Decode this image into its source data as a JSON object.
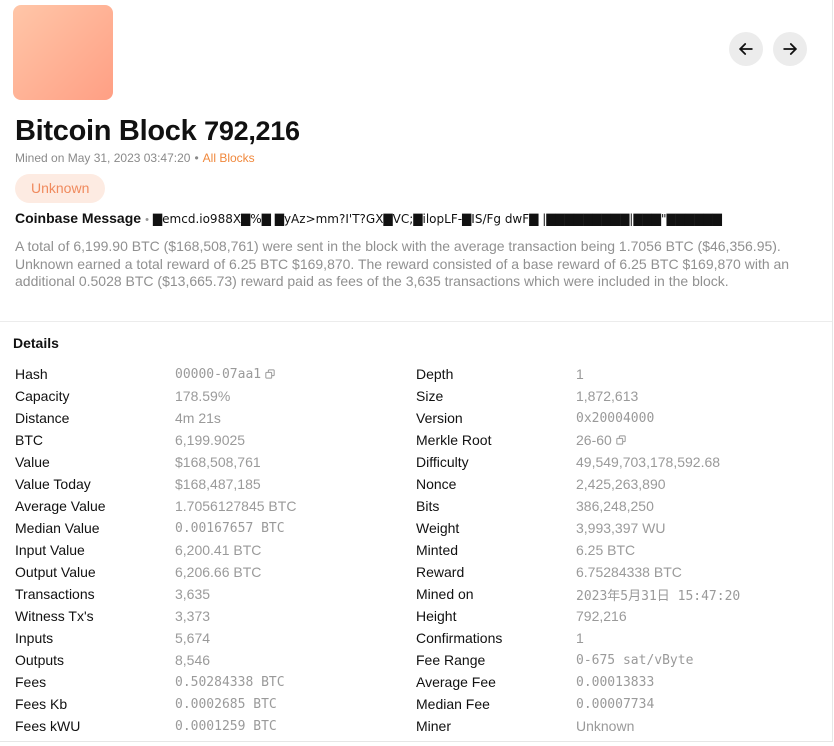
{
  "header": {
    "title_word": "Bitcoin Block",
    "block_number": "792,216",
    "mined_text": "Mined on May 31, 2023 03:47:20",
    "dot": "•",
    "all_blocks_link": "All Blocks",
    "miner_badge": "Unknown"
  },
  "coinbase": {
    "label": "Coinbase Message",
    "separator": "•",
    "message": "▇emcd.io988X▇%▇ ▇yAz>mm?I'T?GX▇VC;▇ilopLF-▇IS/Fg dwF▇ |▇▇▇▇▇▇▇▇▇|▇▇▇\"▇▇▇▇▇▇"
  },
  "summary": "A total of 6,199.90 BTC ($168,508,761) were sent in the block with the average transaction being 1.7056 BTC ($46,356.95). Unknown earned a total reward of 6.25 BTC $169,870. The reward consisted of a base reward of 6.25 BTC $169,870 with an additional 0.5028 BTC ($13,665.73) reward paid as fees of the 3,635 transactions which were included in the block.",
  "details": {
    "heading": "Details",
    "left": [
      {
        "label": "Hash",
        "value": "00000-07aa1",
        "copy": true
      },
      {
        "label": "Capacity",
        "value": "178.59%"
      },
      {
        "label": "Distance",
        "value": "4m 21s"
      },
      {
        "label": "BTC",
        "value": "6,199.9025"
      },
      {
        "label": "Value",
        "value": "$168,508,761"
      },
      {
        "label": "Value Today",
        "value": "$168,487,185"
      },
      {
        "label": "Average Value",
        "value": "1.7056127845 BTC"
      },
      {
        "label": "Median Value",
        "value": "0.00167657 BTC"
      },
      {
        "label": "Input Value",
        "value": "6,200.41 BTC"
      },
      {
        "label": "Output Value",
        "value": "6,206.66 BTC"
      },
      {
        "label": "Transactions",
        "value": "3,635"
      },
      {
        "label": "Witness Tx's",
        "value": "3,373"
      },
      {
        "label": "Inputs",
        "value": "5,674"
      },
      {
        "label": "Outputs",
        "value": "8,546"
      },
      {
        "label": "Fees",
        "value": "0.50284338 BTC"
      },
      {
        "label": "Fees Kb",
        "value": "0.0002685 BTC"
      },
      {
        "label": "Fees kWU",
        "value": "0.0001259 BTC"
      }
    ],
    "right": [
      {
        "label": "Depth",
        "value": "1"
      },
      {
        "label": "Size",
        "value": "1,872,613"
      },
      {
        "label": "Version",
        "value": "0x20004000"
      },
      {
        "label": "Merkle Root",
        "value": "26-60",
        "copy": true
      },
      {
        "label": "Difficulty",
        "value": "49,549,703,178,592.68"
      },
      {
        "label": "Nonce",
        "value": "2,425,263,890"
      },
      {
        "label": "Bits",
        "value": "386,248,250"
      },
      {
        "label": "Weight",
        "value": "3,993,397 WU"
      },
      {
        "label": "Minted",
        "value": "6.25 BTC"
      },
      {
        "label": "Reward",
        "value": "6.75284338 BTC"
      },
      {
        "label": "Mined on",
        "value": "2023年5月31日 15:47:20"
      },
      {
        "label": "Height",
        "value": "792,216"
      },
      {
        "label": "Confirmations",
        "value": "1"
      },
      {
        "label": "Fee Range",
        "value": "0-675 sat/vByte"
      },
      {
        "label": "Average Fee",
        "value": "0.00013833"
      },
      {
        "label": "Median Fee",
        "value": "0.00007734"
      },
      {
        "label": "Miner",
        "value": "Unknown"
      }
    ]
  },
  "icons": {
    "prev": "arrow-left-icon",
    "next": "arrow-right-icon",
    "copy": "copy-icon"
  },
  "colors": {
    "accent": "#f0883c",
    "badge_bg": "#fdebe2",
    "badge_text": "#f08a5d",
    "muted": "#909090"
  }
}
